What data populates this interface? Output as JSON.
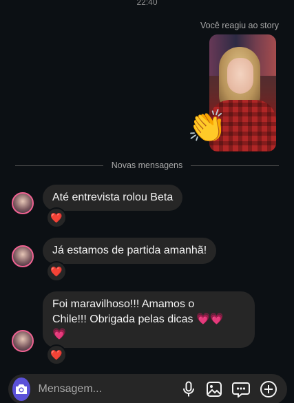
{
  "status": {
    "time": "22:40"
  },
  "story_reply": {
    "label": "Você reagiu ao story",
    "reaction_emoji": "👏"
  },
  "divider": {
    "label": "Novas mensagens"
  },
  "messages": [
    {
      "text": "Até entrevista rolou Beta",
      "reaction": "❤️"
    },
    {
      "text": "Já estamos de partida amanhã!",
      "reaction": "❤️"
    },
    {
      "text": "Foi maravilhoso!!! Amamos o Chile!!! Obrigada pelas dicas 💗💗 💗",
      "line1": "Foi maravilhoso!!! Amamos o",
      "line2": "Chile!!! Obrigada pelas dicas 💗💗",
      "line3": "💗",
      "reaction": "❤️"
    }
  ],
  "composer": {
    "placeholder": "Mensagem...",
    "icons": [
      "camera-icon",
      "microphone-icon",
      "gallery-icon",
      "sticker-icon",
      "plus-icon"
    ]
  },
  "colors": {
    "background": "#0c1014",
    "bubble": "#262626",
    "accent": "#5b51d8"
  }
}
